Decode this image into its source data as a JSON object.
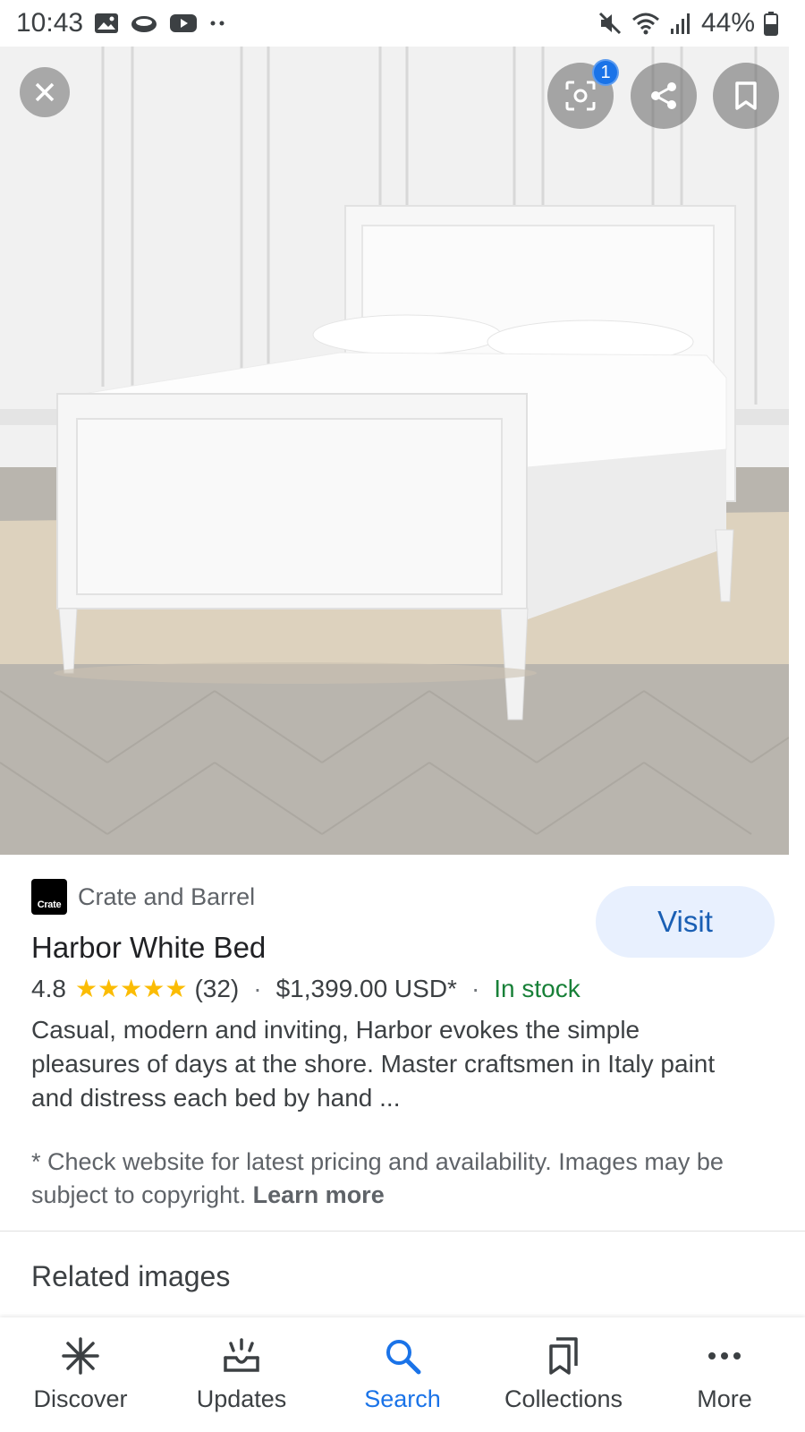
{
  "status_bar": {
    "time": "10:43",
    "battery": "44%",
    "left_icons": [
      "gallery-icon",
      "cloud-icon",
      "youtube-icon",
      "more-dots-icon"
    ],
    "right_icons": [
      "mute-icon",
      "wifi-icon",
      "signal-icon",
      "battery-icon"
    ]
  },
  "image_viewer": {
    "lens_badge_count": "1",
    "top_icons": [
      "close-icon",
      "lens-icon",
      "share-icon",
      "bookmark-icon"
    ]
  },
  "product": {
    "source_logo_text": "Crate",
    "source_name": "Crate and Barrel",
    "title": "Harbor White Bed",
    "rating": "4.8",
    "rating_stars": 5,
    "stars_text": "★★★★★",
    "review_count": "(32)",
    "price": "$1,399.00 USD*",
    "availability": "In stock",
    "description": "Casual, modern and inviting, Harbor evokes the simple pleasures of days at the shore. Master craftsmen in Italy paint and distress each bed by hand ...",
    "visit_label": "Visit"
  },
  "disclaimer": {
    "text": "* Check website for latest pricing and availability. Images may be subject to copyright.",
    "link": "Learn more"
  },
  "related": {
    "title": "Related images"
  },
  "bottom_nav": {
    "items": [
      {
        "label": "Discover",
        "icon": "asterisk-icon"
      },
      {
        "label": "Updates",
        "icon": "updates-icon"
      },
      {
        "label": "Search",
        "icon": "search-icon",
        "active": true
      },
      {
        "label": "Collections",
        "icon": "collections-icon"
      },
      {
        "label": "More",
        "icon": "more-icon"
      }
    ]
  },
  "colors": {
    "accent": "#1a73e8",
    "in_stock": "#188038",
    "star": "#fbbc04",
    "visit_bg": "#e8f0fe"
  }
}
